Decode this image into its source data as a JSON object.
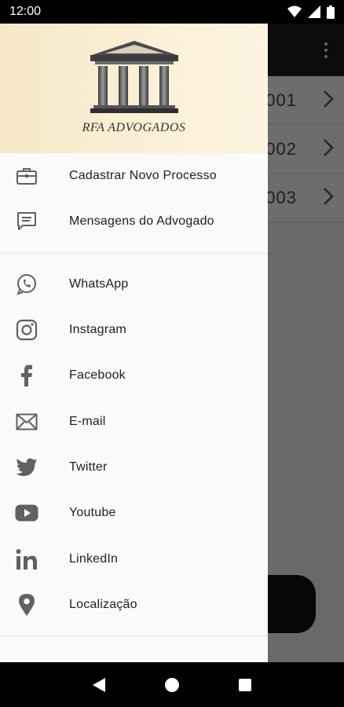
{
  "status": {
    "time": "12:00"
  },
  "background": {
    "rows": [
      {
        "number": "001"
      },
      {
        "number": "002"
      },
      {
        "number": "003"
      }
    ]
  },
  "drawer": {
    "brand": "RFA ADVOGADOS",
    "section1": [
      {
        "label": "Cadastrar Novo Processo",
        "icon": "briefcase-icon"
      },
      {
        "label": "Mensagens do Advogado",
        "icon": "message-icon"
      }
    ],
    "section2": [
      {
        "label": "WhatsApp",
        "icon": "whatsapp-icon"
      },
      {
        "label": "Instagram",
        "icon": "instagram-icon"
      },
      {
        "label": "Facebook",
        "icon": "facebook-icon"
      },
      {
        "label": "E-mail",
        "icon": "email-icon"
      },
      {
        "label": "Twitter",
        "icon": "twitter-icon"
      },
      {
        "label": "Youtube",
        "icon": "youtube-icon"
      },
      {
        "label": "LinkedIn",
        "icon": "linkedin-icon"
      },
      {
        "label": "Localização",
        "icon": "location-icon"
      }
    ]
  },
  "colors": {
    "header_start": "#f6e8c7",
    "header_end": "#fdf4e1",
    "icon": "#616161",
    "text": "#212121"
  }
}
